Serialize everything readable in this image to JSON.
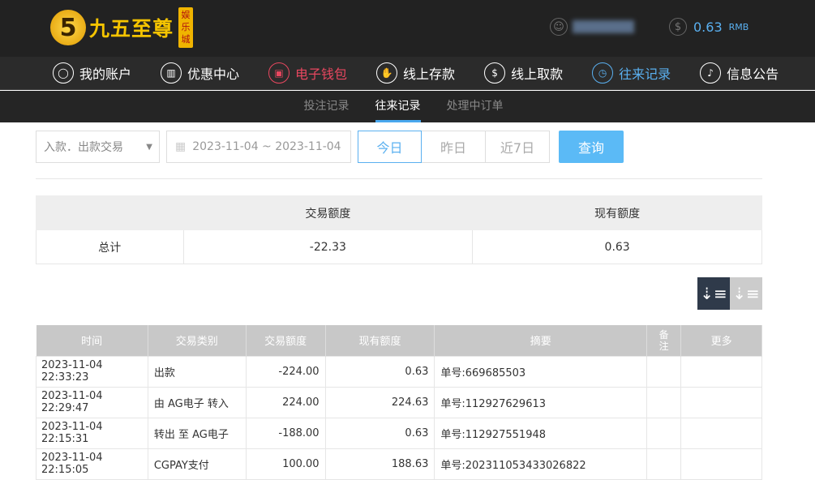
{
  "header": {
    "logo_text": "九五至尊",
    "logo_badge": "娱乐城",
    "logo_digit": "5",
    "balance": "0.63",
    "currency": "RMB"
  },
  "nav": [
    {
      "label": "我的账户",
      "icon": "user-icon"
    },
    {
      "label": "优惠中心",
      "icon": "gift-icon"
    },
    {
      "label": "电子钱包",
      "icon": "wallet-icon"
    },
    {
      "label": "线上存款",
      "icon": "deposit-icon"
    },
    {
      "label": "线上取款",
      "icon": "withdraw-icon"
    },
    {
      "label": "往来记录",
      "icon": "records-icon"
    },
    {
      "label": "信息公告",
      "icon": "bell-icon"
    }
  ],
  "subnav": [
    "投注记录",
    "往来记录",
    "处理中订单"
  ],
  "filter": {
    "type": "入款．出款交易",
    "date_range": "2023-11-04 ~ 2023-11-04",
    "quick": [
      "今日",
      "昨日",
      "近7日"
    ],
    "query": "查询"
  },
  "summary": {
    "headers": [
      "",
      "交易额度",
      "现有额度"
    ],
    "row": [
      "总计",
      "-22.33",
      "0.63"
    ]
  },
  "table": {
    "headers": [
      "时间",
      "交易类别",
      "交易额度",
      "现有额度",
      "摘要",
      "备注",
      "更多"
    ],
    "rows": [
      [
        "2023-11-04 22:33:23",
        "出款",
        "-224.00",
        "0.63",
        "单号:669685503",
        "",
        ""
      ],
      [
        "2023-11-04 22:29:47",
        "由 AG电子 转入",
        "224.00",
        "224.63",
        "单号:112927629613",
        "",
        ""
      ],
      [
        "2023-11-04 22:15:31",
        "转出 至 AG电子",
        "-188.00",
        "0.63",
        "单号:112927551948",
        "",
        ""
      ],
      [
        "2023-11-04 22:15:05",
        "CGPAY支付",
        "100.00",
        "188.63",
        "单号:202311053433026822",
        "",
        ""
      ]
    ]
  },
  "colors": {
    "accent": "#5ab0f0",
    "wallet": "#e8475f"
  }
}
